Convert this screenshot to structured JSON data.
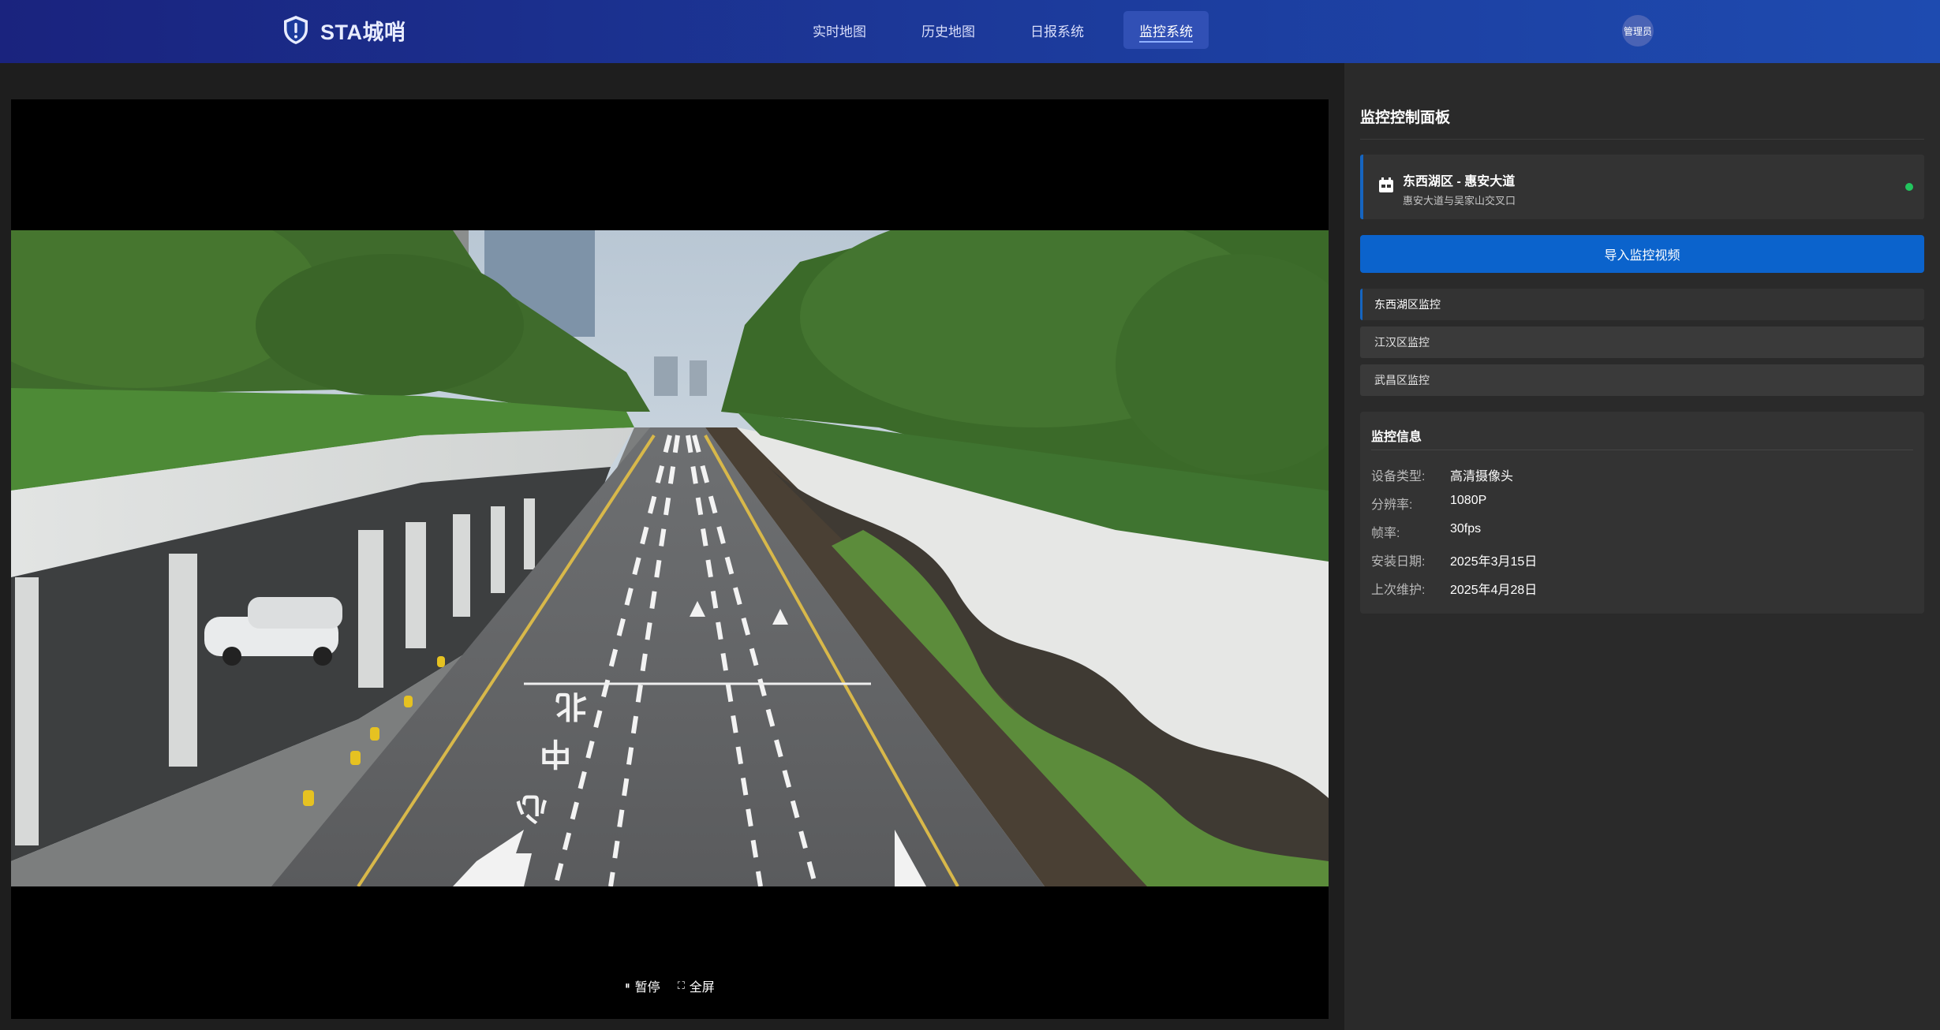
{
  "header": {
    "brand": "STA城哨",
    "nav": [
      {
        "label": "实时地图",
        "active": false
      },
      {
        "label": "历史地图",
        "active": false
      },
      {
        "label": "日报系统",
        "active": false
      },
      {
        "label": "监控系统",
        "active": true
      }
    ],
    "user": "管理员"
  },
  "video": {
    "controls": {
      "pause": "暂停",
      "fullscreen": "全屏"
    },
    "pause_icon": "pause-icon",
    "fullscreen_icon": "fullscreen-icon",
    "road_markings": [
      "中",
      "北",
      "心"
    ]
  },
  "panel": {
    "title": "监控控制面板",
    "camera": {
      "name": "东西湖区 - 惠安大道",
      "location": "惠安大道与吴家山交叉口",
      "status_color": "#22c55e",
      "icon": "calendar-camera-icon"
    },
    "import_button": "导入监控视频",
    "districts": [
      {
        "label": "东西湖区监控",
        "active": true
      },
      {
        "label": "江汉区监控",
        "active": false
      },
      {
        "label": "武昌区监控",
        "active": false
      }
    ],
    "info": {
      "title": "监控信息",
      "rows": [
        {
          "label": "设备类型:",
          "value": "高清摄像头"
        },
        {
          "label": "分辨率:",
          "value": "1080P"
        },
        {
          "label": "帧率:",
          "value": "30fps"
        },
        {
          "label": "安装日期:",
          "value": "2025年3月15日"
        },
        {
          "label": "上次维护:",
          "value": "2025年4月28日"
        }
      ]
    }
  },
  "colors": {
    "header_start": "#1a237e",
    "header_end": "#1e4bb0",
    "accent": "#0b63cc",
    "status_online": "#22c55e"
  }
}
